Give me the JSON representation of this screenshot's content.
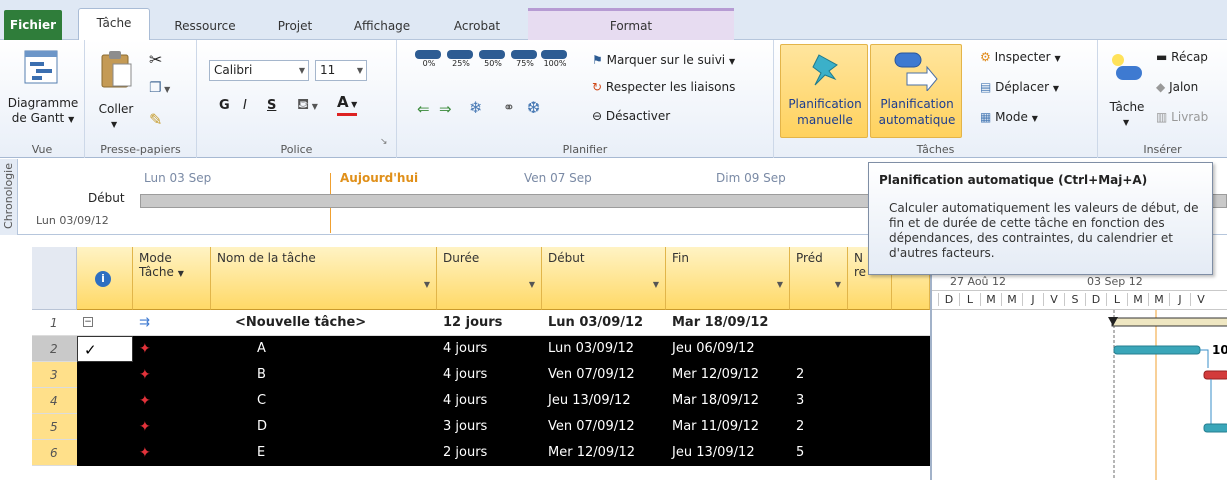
{
  "tabs": [
    {
      "label": "Fichier",
      "kind": "file"
    },
    {
      "label": "Tâche",
      "kind": "active"
    },
    {
      "label": "Ressource",
      "kind": "normal"
    },
    {
      "label": "Projet",
      "kind": "normal"
    },
    {
      "label": "Affichage",
      "kind": "normal"
    },
    {
      "label": "Acrobat",
      "kind": "normal"
    },
    {
      "label": "Format",
      "kind": "contextual"
    }
  ],
  "ribbon": {
    "vue": {
      "button_line1": "Diagramme",
      "button_line2": "de Gantt",
      "label": "Vue"
    },
    "presse_papiers": {
      "coller": "Coller",
      "label": "Presse-papiers"
    },
    "police": {
      "font": "Calibri",
      "size": "11",
      "bold": "G",
      "italic": "I",
      "underline": "S",
      "label": "Police"
    },
    "planifier": {
      "pct": [
        "0%",
        "25%",
        "50%",
        "75%",
        "100%"
      ],
      "marquer": "Marquer sur le suivi",
      "respecter": "Respecter les liaisons",
      "desactiver": "Désactiver",
      "label": "Planifier"
    },
    "taches": {
      "manuelle_line1": "Planification",
      "manuelle_line2": "manuelle",
      "auto_line1": "Planification",
      "auto_line2": "automatique",
      "inspecter": "Inspecter",
      "deplacer": "Déplacer",
      "mode": "Mode",
      "label": "Tâches"
    },
    "inserer": {
      "tache": "Tâche",
      "recap": "Récap",
      "jalon": "Jalon",
      "livrab": "Livrab",
      "label": "Insérer"
    }
  },
  "timeline": {
    "side_label": "Chronologie",
    "dates": [
      "Lun 03 Sep",
      "Aujourd'hui",
      "Ven 07 Sep",
      "Dim 09 Sep"
    ],
    "start_label": "Début",
    "start_date": "Lun 03/09/12"
  },
  "tooltip": {
    "title": "Planification automatique (Ctrl+Maj+A)",
    "body": "Calculer automatiquement les valeurs de début, de fin et de durée de cette tâche en fonction des dépendances, des contraintes, du calendrier et d'autres facteurs."
  },
  "grid": {
    "headers": {
      "mode_line1": "Mode",
      "mode_line2": "Tâche",
      "name": "Nom de la tâche",
      "duration": "Durée",
      "start": "Début",
      "finish": "Fin",
      "pred": "Préd",
      "extra_line1": "N",
      "extra_line2": "re"
    },
    "rows": [
      {
        "num": "1",
        "name": "<Nouvelle tâche>",
        "duration": "12 jours",
        "start": "Lun 03/09/12",
        "finish": "Mar 18/09/12",
        "pred": "",
        "summary": true
      },
      {
        "num": "2",
        "name": "A",
        "duration": "4 jours",
        "start": "Lun 03/09/12",
        "finish": "Jeu 06/09/12",
        "pred": "",
        "summary": false
      },
      {
        "num": "3",
        "name": "B",
        "duration": "4 jours",
        "start": "Ven 07/09/12",
        "finish": "Mer 12/09/12",
        "pred": "2",
        "summary": false
      },
      {
        "num": "4",
        "name": "C",
        "duration": "4 jours",
        "start": "Jeu 13/09/12",
        "finish": "Mar 18/09/12",
        "pred": "3",
        "summary": false
      },
      {
        "num": "5",
        "name": "D",
        "duration": "3 jours",
        "start": "Ven 07/09/12",
        "finish": "Mar 11/09/12",
        "pred": "2",
        "summary": false
      },
      {
        "num": "6",
        "name": "E",
        "duration": "2 jours",
        "start": "Mer 12/09/12",
        "finish": "Jeu 13/09/12",
        "pred": "5",
        "summary": false
      }
    ]
  },
  "gantt": {
    "weeks": [
      "27 Aoû 12",
      "03 Sep 12"
    ],
    "days": [
      "D",
      "L",
      "M",
      "M",
      "J",
      "V",
      "S",
      "D",
      "L",
      "M",
      "M",
      "J",
      "V"
    ],
    "bar_label": "10"
  },
  "colors": {
    "accent": "#2f7d3a",
    "header_yellow": "#ffd967",
    "gantt_task_blue": "#3aa6b9",
    "gantt_critical_red": "#d33b3b",
    "today_line": "#f0a030"
  }
}
